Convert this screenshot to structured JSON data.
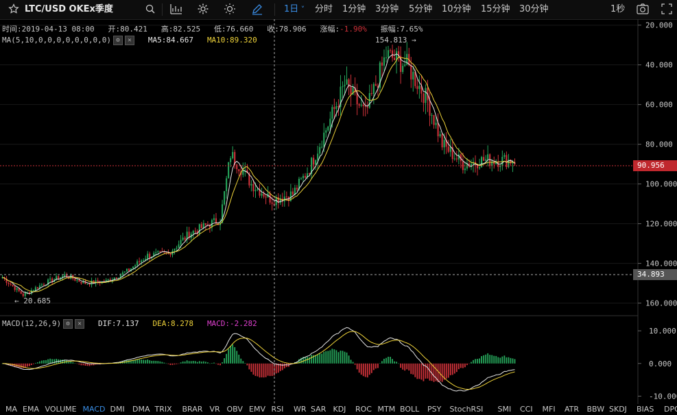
{
  "toolbar": {
    "symbol": "LTC/USD OKEx季度",
    "intervals": [
      "1日",
      "分时",
      "1分钟",
      "3分钟",
      "5分钟",
      "10分钟",
      "15分钟",
      "30分钟"
    ],
    "active_interval": "1日",
    "countdown": "1秒"
  },
  "ohlc": {
    "time_label": "时间:",
    "time": "2019-04-13 08:00",
    "open_label": "开:",
    "open": "80.421",
    "high_label": "高:",
    "high": "82.525",
    "low_label": "低:",
    "low": "76.660",
    "close_label": "收:",
    "close": "78.906",
    "change_label": "涨幅:",
    "change": "-1.90%",
    "amplitude_label": "振幅:",
    "amplitude": "7.65%"
  },
  "ma_legend": {
    "name": "MA(5,10,0,0,0,0,0,0,0,0)",
    "ma5": "MA5:84.667",
    "ma10": "MA10:89.320"
  },
  "macd_legend": {
    "name": "MACD(12,26,9)",
    "dif": "DIF:7.137",
    "dea": "DEA:8.278",
    "macd": "MACD:-2.282"
  },
  "price_axis": {
    "ticks": [
      "160.000",
      "140.000",
      "120.000",
      "100.000",
      "80.000",
      "60.000",
      "40.000",
      "20.000"
    ],
    "current_price": "90.956",
    "crosshair_price": "34.893"
  },
  "macd_axis": {
    "ticks": [
      "10.000",
      "0.000",
      "-10.000"
    ]
  },
  "annotations": {
    "high": "154.813 →",
    "low": "← 20.685"
  },
  "indicators": [
    "MA",
    "EMA",
    "VOLUME",
    "MACD",
    "DMI",
    "DMA",
    "TRIX",
    "BRAR",
    "VR",
    "OBV",
    "EMV",
    "RSI",
    "WR",
    "SAR",
    "KDJ",
    "ROC",
    "MTM",
    "BOLL",
    "PSY",
    "StochRSI",
    "SMI",
    "CCI",
    "MFI",
    "ATR",
    "BBW",
    "SKDJ",
    "BIAS",
    "DPO"
  ],
  "active_indicator": "MACD",
  "colors": {
    "up": "#26a65b",
    "down": "#d0323a",
    "ma5": "#e8e8e8",
    "ma10": "#f0d43a",
    "dif": "#e8e8e8",
    "dea": "#f0d43a",
    "active": "#3a8ee6",
    "accent": "#3a8ee6"
  },
  "chart_data": [
    {
      "type": "candlestick",
      "title": "LTC/USD OKEx季度",
      "ylim": [
        14,
        163
      ],
      "y_ticks": [
        20,
        40,
        60,
        80,
        100,
        120,
        140,
        160
      ],
      "current_price": 90.956,
      "annotated_high": 154.813,
      "annotated_low": 20.685,
      "close_anchors": [
        [
          0,
          33
        ],
        [
          10,
          24
        ],
        [
          20,
          30
        ],
        [
          30,
          34
        ],
        [
          40,
          30
        ],
        [
          50,
          31
        ],
        [
          60,
          36
        ],
        [
          70,
          44
        ],
        [
          80,
          45
        ],
        [
          90,
          55
        ],
        [
          100,
          60
        ],
        [
          105,
          62
        ],
        [
          110,
          95
        ],
        [
          115,
          88
        ],
        [
          120,
          80
        ],
        [
          130,
          72
        ],
        [
          140,
          75
        ],
        [
          148,
          88
        ],
        [
          155,
          105
        ],
        [
          165,
          130
        ],
        [
          175,
          115
        ],
        [
          185,
          145
        ],
        [
          195,
          140
        ],
        [
          205,
          122
        ],
        [
          212,
          100
        ],
        [
          222,
          90
        ],
        [
          232,
          92
        ],
        [
          247,
          92
        ]
      ],
      "candle_count": 248,
      "series": [
        {
          "name": "MA5",
          "value_last": 84.667
        },
        {
          "name": "MA10",
          "value_last": 89.32
        }
      ]
    },
    {
      "type": "macd",
      "ylim": [
        -12,
        14
      ],
      "y_ticks": [
        10,
        0,
        -10
      ],
      "series": [
        {
          "name": "DIF",
          "value_last": 7.137
        },
        {
          "name": "DEA",
          "value_last": 8.278
        },
        {
          "name": "MACD",
          "value_last": -2.282
        }
      ]
    }
  ]
}
